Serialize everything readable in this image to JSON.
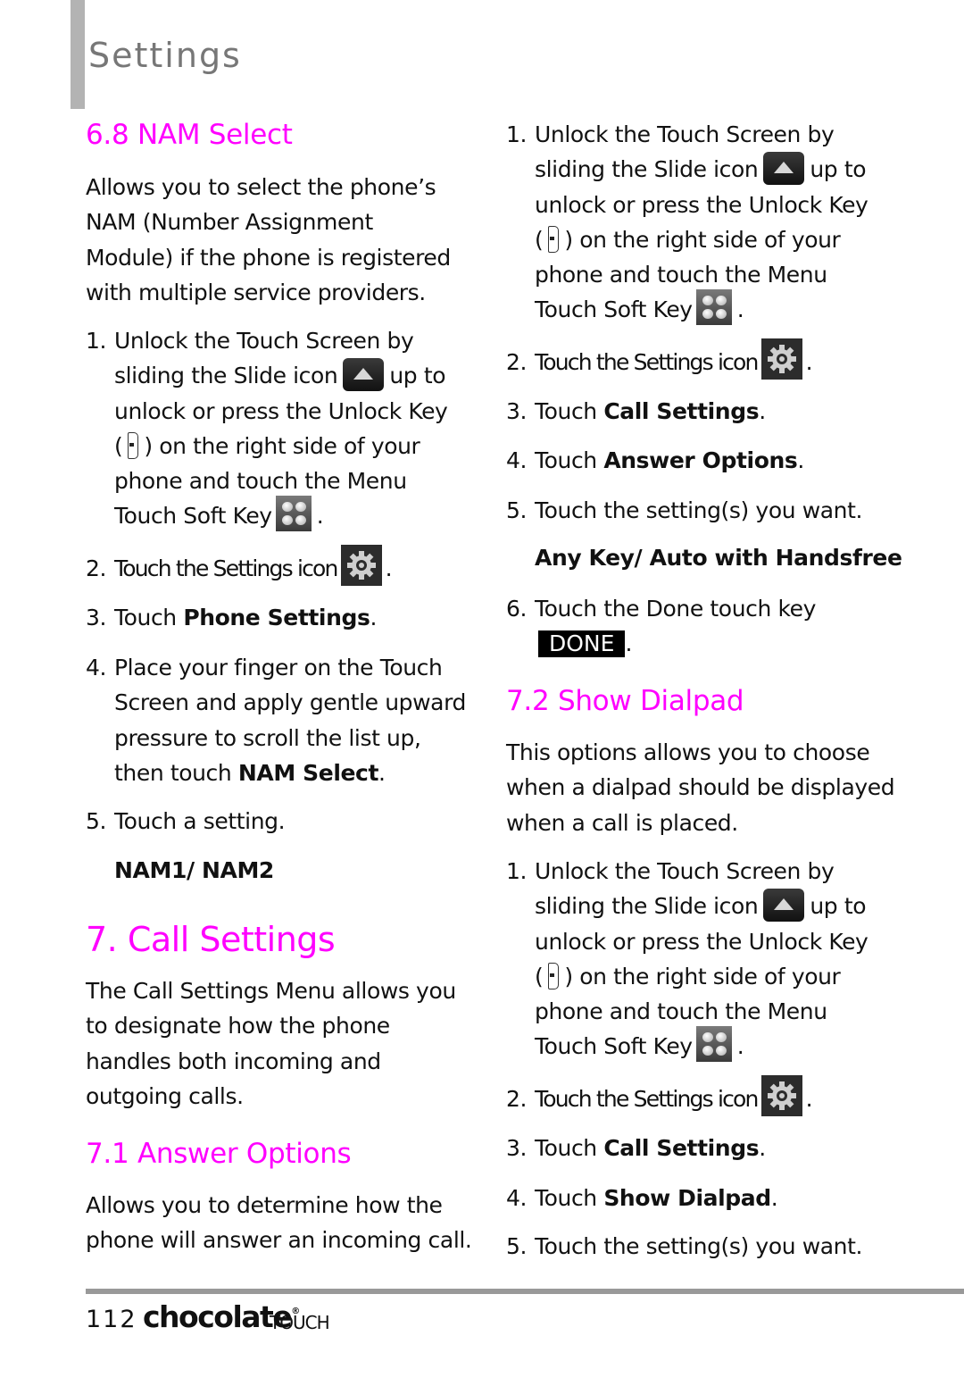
{
  "header": {
    "title": "Settings"
  },
  "colors": {
    "heading": "#ff00ff",
    "text": "#111111",
    "header_bar": "#b3b3b3",
    "footer_rule": "#999999"
  },
  "nam_select": {
    "heading": "6.8 NAM Select",
    "description": [
      "Allows you to select the phone’s",
      "NAM (Number Assignment",
      "Module) if the phone is registered",
      "with multiple service providers."
    ],
    "step1": {
      "num": "1.",
      "line1": "Unlock the Touch Screen by",
      "line2a": "sliding the Slide icon",
      "line2b": "up to",
      "line3": "unlock or press the Unlock Key",
      "line4a": "(",
      "line4b": ") on the right side of your",
      "line5": "phone and touch the Menu",
      "line6a": "Touch Soft Key",
      "line6b": "."
    },
    "step2": {
      "num": "2.",
      "text": "Touch the Settings icon",
      "end": "."
    },
    "step3": {
      "num": "3.",
      "prefix": "Touch ",
      "bold": "Phone Settings",
      "end": "."
    },
    "step4": {
      "num": "4.",
      "line1": "Place your finger on the Touch",
      "line2": "Screen and apply gentle upward",
      "line3": "pressure to scroll the list up,",
      "line4_prefix": "then touch ",
      "line4_bold": "NAM Select",
      "line4_end": "."
    },
    "step5": {
      "num": "5.",
      "text": "Touch a setting."
    },
    "options": "NAM1/ NAM2"
  },
  "call_settings": {
    "heading": "7. Call Settings",
    "description": [
      "The Call Settings Menu allows you",
      "to designate how the phone",
      "handles both incoming and",
      "outgoing calls."
    ]
  },
  "answer_options": {
    "heading": "7.1 Answer Options",
    "description": [
      "Allows you to determine how the",
      "phone will answer an incoming call."
    ],
    "step1": {
      "num": "1.",
      "line1": "Unlock the Touch Screen by",
      "line2a": "sliding the Slide icon",
      "line2b": "up to",
      "line3": "unlock or press the Unlock Key",
      "line4a": "(",
      "line4b": ") on the right side of your",
      "line5": "phone and touch the Menu",
      "line6a": "Touch Soft Key",
      "line6b": "."
    },
    "step2": {
      "num": "2.",
      "text": "Touch the Settings icon",
      "end": "."
    },
    "step3": {
      "num": "3.",
      "prefix": "Touch ",
      "bold": "Call Settings",
      "end": "."
    },
    "step4": {
      "num": "4.",
      "prefix": "Touch ",
      "bold": "Answer Options",
      "end": "."
    },
    "step5": {
      "num": "5.",
      "text": "Touch the setting(s) you want."
    },
    "options": "Any Key/ Auto with Handsfree",
    "step6": {
      "num": "6.",
      "text": "Touch the Done touch key",
      "done_label": "DONE",
      "end": "."
    }
  },
  "show_dialpad": {
    "heading": "7.2 Show Dialpad",
    "description": [
      "This options allows you to choose",
      "when a dialpad should be displayed",
      "when a call is placed."
    ],
    "step1": {
      "num": "1.",
      "line1": "Unlock the Touch Screen by",
      "line2a": "sliding the Slide icon",
      "line2b": "up to",
      "line3": "unlock or press the Unlock Key",
      "line4a": "(",
      "line4b": ") on the right side of your",
      "line5": "phone and touch the Menu",
      "line6a": "Touch Soft Key",
      "line6b": "."
    },
    "step2": {
      "num": "2.",
      "text": "Touch the Settings icon",
      "end": "."
    },
    "step3": {
      "num": "3.",
      "prefix": "Touch ",
      "bold": "Call Settings",
      "end": "."
    },
    "step4": {
      "num": "4.",
      "prefix": "Touch ",
      "bold": "Show Dialpad",
      "end": "."
    },
    "step5": {
      "num": "5.",
      "text": "Touch the setting(s) you want."
    }
  },
  "footer": {
    "page_number": "112",
    "brand": "chocolate",
    "brand_mark": "®",
    "brand_sub": "TOUCH"
  },
  "icons": {
    "slide": "slide-up-icon",
    "unlock_key": "unlock-key-icon",
    "menu": "menu-soft-key-icon",
    "settings": "settings-gear-icon",
    "done": "done-key"
  }
}
